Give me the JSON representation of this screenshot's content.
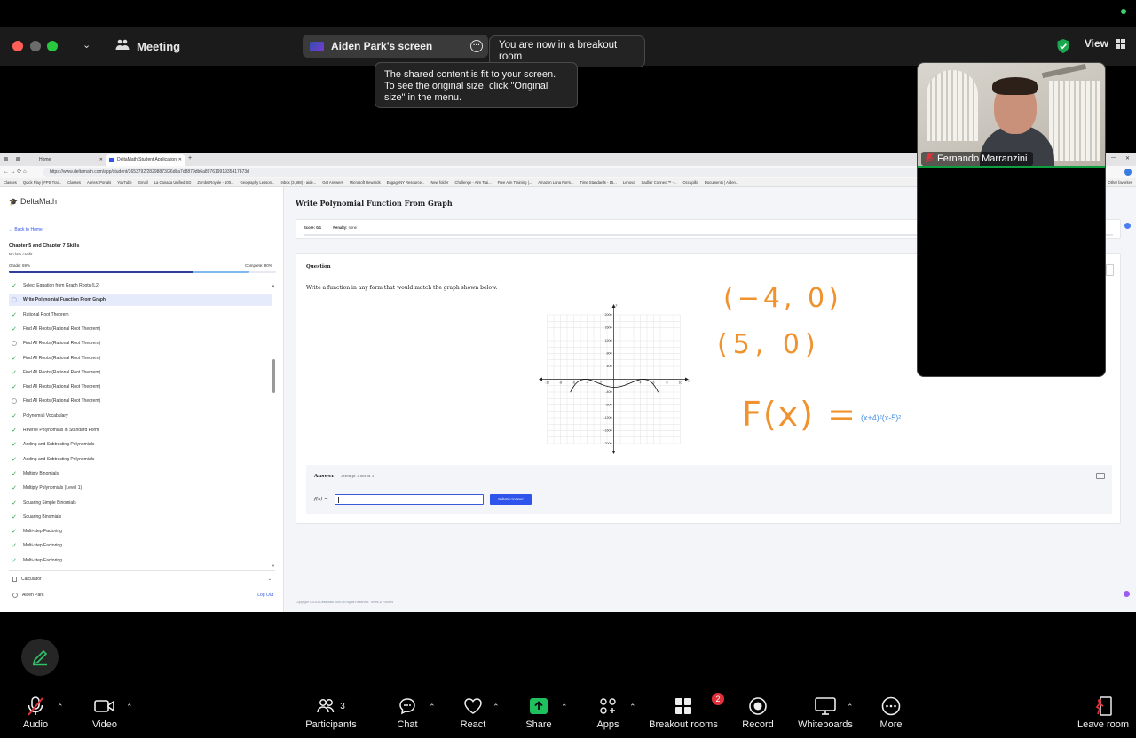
{
  "meeting": {
    "title": "Meeting",
    "share_title": "Aiden Park's screen",
    "breakout_notice": "You are now in a breakout room",
    "fit_tooltip": [
      "The shared content is fit to your screen.",
      "To see the original size, click \"Original",
      "size\" in the menu."
    ],
    "view_label": "View"
  },
  "participant": {
    "name": "Fernando Marranzini"
  },
  "browser": {
    "tabs": [
      "Home",
      "DeltaMath Student Application"
    ],
    "url": "https://www.deltamath.com/app/student/3653792/28298873/26dba7d8879db6a89761991935417873d",
    "bookmarks": [
      "Classes",
      "Quick Play | FPS Trai...",
      "Classes",
      "Aeries: Portals",
      "YouTube",
      "Gmail",
      "La Canada Unified SD",
      "Zombs Royale - 100...",
      "Geography Lesson...",
      "Inbox (3,598) - aide...",
      "Get Answers",
      "Microsoft Rewards",
      "EngageNY Resource...",
      "New folder",
      "Challenge - Aim Trai...",
      "Free Aim Training |...",
      "Amazon Luna Form...",
      "Time Standards - 15...",
      "Lenovo",
      "Sadlier Connect™ -...",
      "Occupilla",
      "Documents | Aiden..."
    ],
    "other_bookmarks": "Other favorites"
  },
  "sidebar": {
    "logo": "DeltaMath",
    "back": "← Back to Home",
    "assignment": "Chapter 5 and Chapter 7 Skills",
    "late": "No late credit",
    "grade": "Grade: 69%",
    "complete": "Complete: 90%",
    "grade_pct": 69,
    "complete_pct": 90,
    "items": [
      {
        "label": "Select Equation from Graph Roots (L2)",
        "done": true
      },
      {
        "label": "Write Polynomial Function From Graph",
        "done": false,
        "active": true
      },
      {
        "label": "Rational Root Theorem",
        "done": true
      },
      {
        "label": "Find All Roots (Rational Root Theorem)",
        "done": true
      },
      {
        "label": "Find All Roots (Rational Root Theorem)",
        "done": false
      },
      {
        "label": "Find All Roots (Rational Root Theorem)",
        "done": true
      },
      {
        "label": "Find All Roots (Rational Root Theorem)",
        "done": true
      },
      {
        "label": "Find All Roots (Rational Root Theorem)",
        "done": true
      },
      {
        "label": "Find All Roots (Rational Root Theorem)",
        "done": false
      },
      {
        "label": "Polynomial Vocabulary",
        "done": true
      },
      {
        "label": "Rewrite Polynomials in Standard Form",
        "done": true
      },
      {
        "label": "Adding and Subtracting Polynomials",
        "done": true
      },
      {
        "label": "Adding and Subtracting Polynomials",
        "done": true
      },
      {
        "label": "Multiply Binomials",
        "done": true
      },
      {
        "label": "Multiply Polynomials (Level 1)",
        "done": true
      },
      {
        "label": "Squaring Simple Binomials",
        "done": true
      },
      {
        "label": "Squaring Binomials",
        "done": true
      },
      {
        "label": "Multi-step Factoring",
        "done": true
      },
      {
        "label": "Multi-step Factoring",
        "done": true
      },
      {
        "label": "Multi-step Factoring",
        "done": true
      }
    ],
    "calculator": "Calculator",
    "user": "Aiden Park",
    "logout": "Log Out"
  },
  "problem": {
    "title": "Write Polynomial Function From Graph",
    "score": "Score: 0/1",
    "penalty_label": "Penalty:",
    "penalty_value": "none",
    "question_heading": "Question",
    "question_text": "Write a function in any form that would match the graph shown below.",
    "answer_heading": "Answer",
    "attempt": "Attempt 1 out of 3",
    "fx_label": "f(x) =",
    "submit": "Submit Answer",
    "footer": "Copyright ©2023 DeltaMath.com All Rights Reserved. Terms & Policies"
  },
  "graph": {
    "x_ticks": [
      "-10",
      "-8",
      "-6",
      "-4",
      "-2",
      "2",
      "4",
      "6",
      "8",
      "10"
    ],
    "y_ticks": [
      "2000",
      "1600",
      "1200",
      "800",
      "400",
      "-400",
      "-800",
      "-1200",
      "-1600",
      "-2000"
    ],
    "x_axis": "x",
    "y_axis": "y"
  },
  "annotations": {
    "point1": "(−4, 0)",
    "point2": "(5, 0)",
    "fx": "F(x) =",
    "typed": "(x+4)²(x-5)²"
  },
  "toolbar": {
    "audio": "Audio",
    "video": "Video",
    "participants": "Participants",
    "participants_count": "3",
    "chat": "Chat",
    "react": "React",
    "share": "Share",
    "apps": "Apps",
    "breakout": "Breakout rooms",
    "breakout_badge": "2",
    "record": "Record",
    "whiteboards": "Whiteboards",
    "more": "More",
    "leave": "Leave room"
  },
  "colors": {
    "accent_green": "#0e9f3e",
    "share_green": "#1fc15f",
    "badge_red": "#e0313b",
    "deltamath_blue": "#2f54eb",
    "annotation_orange": "#f0922e"
  }
}
